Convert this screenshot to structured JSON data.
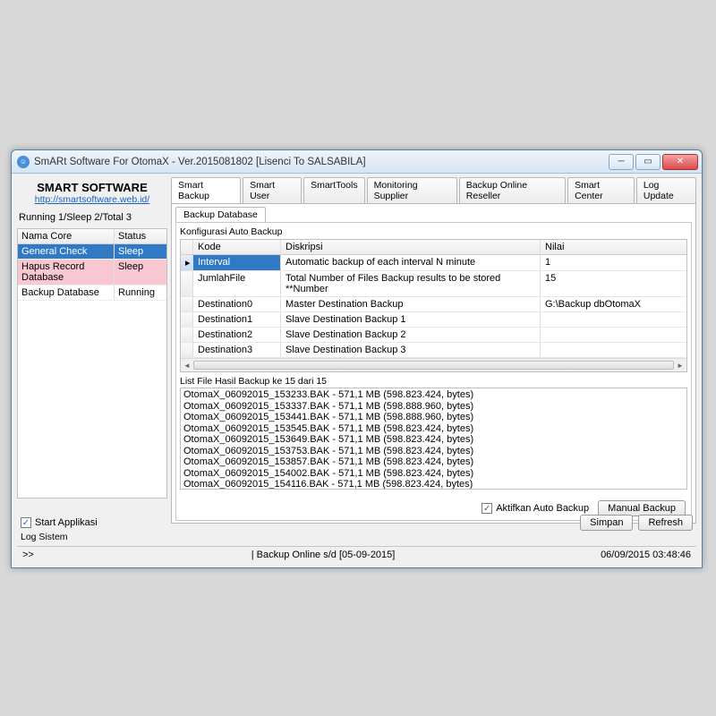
{
  "window": {
    "title": "SmARt Software For OtomaX - Ver.2015081802 [Lisenci To SALSABILA]",
    "icon_letter": "☺"
  },
  "sidebar": {
    "brand_title": "SMART SOFTWARE",
    "brand_link": "http://smartsoftware.web.id/",
    "running_status": "Running 1/Sleep 2/Total 3",
    "columns": {
      "nama": "Nama Core",
      "status": "Status"
    },
    "rows": [
      {
        "nama": "General Check",
        "status": "Sleep",
        "style": "sel"
      },
      {
        "nama": "Hapus Record Database",
        "status": "Sleep",
        "style": "pink"
      },
      {
        "nama": "Backup Database",
        "status": "Running",
        "style": ""
      }
    ]
  },
  "tabs": [
    "Smart Backup",
    "Smart User",
    "SmartTools",
    "Monitoring Supplier",
    "Backup Online Reseller",
    "Smart Center",
    "Log Update"
  ],
  "active_tab": 0,
  "subtab": "Backup Database",
  "group_label": "Konfigurasi Auto Backup",
  "cfg_columns": {
    "kode": "Kode",
    "diskripsi": "Diskripsi",
    "nilai": "Nilai"
  },
  "cfg_rows": [
    {
      "kode": "Interval",
      "diskripsi": "Automatic backup of each interval N minute",
      "nilai": "1",
      "selected": true
    },
    {
      "kode": "JumlahFile",
      "diskripsi": "Total Number of Files Backup results to be stored  **Number",
      "nilai": "15",
      "selected": false
    },
    {
      "kode": "Destination0",
      "diskripsi": "Master Destination Backup",
      "nilai": "G:\\Backup dbOtomaX",
      "selected": false
    },
    {
      "kode": "Destination1",
      "diskripsi": "Slave Destination Backup 1",
      "nilai": "",
      "selected": false
    },
    {
      "kode": "Destination2",
      "diskripsi": "Slave Destination Backup 2",
      "nilai": "",
      "selected": false
    },
    {
      "kode": "Destination3",
      "diskripsi": "Slave Destination Backup 3",
      "nilai": "",
      "selected": false
    }
  ],
  "list_label": "List File Hasil Backup ke 15 dari 15",
  "list_items": [
    "OtomaX_06092015_153233.BAK - 571,1 MB (598.823.424, bytes)",
    "OtomaX_06092015_153337.BAK - 571,1 MB (598.888.960, bytes)",
    "OtomaX_06092015_153441.BAK - 571,1 MB (598.888.960, bytes)",
    "OtomaX_06092015_153545.BAK - 571,1 MB (598.823.424, bytes)",
    "OtomaX_06092015_153649.BAK - 571,1 MB (598.823.424, bytes)",
    "OtomaX_06092015_153753.BAK - 571,1 MB (598.823.424, bytes)",
    "OtomaX_06092015_153857.BAK - 571,1 MB (598.823.424, bytes)",
    "OtomaX_06092015_154002.BAK - 571,1 MB (598.823.424, bytes)",
    "OtomaX_06092015_154116.BAK - 571,1 MB (598.823.424, bytes)"
  ],
  "checkbox_auto": "Aktifkan Auto Backup",
  "btn_manual": "Manual Backup",
  "footer": {
    "start_app": "Start Applikasi",
    "simpan": "Simpan",
    "refresh": "Refresh",
    "log_sistem": "Log Sistem"
  },
  "statusbar": {
    "left": ">>",
    "mid": "| Backup Online s/d [05-09-2015]",
    "right": "06/09/2015 03:48:46"
  }
}
